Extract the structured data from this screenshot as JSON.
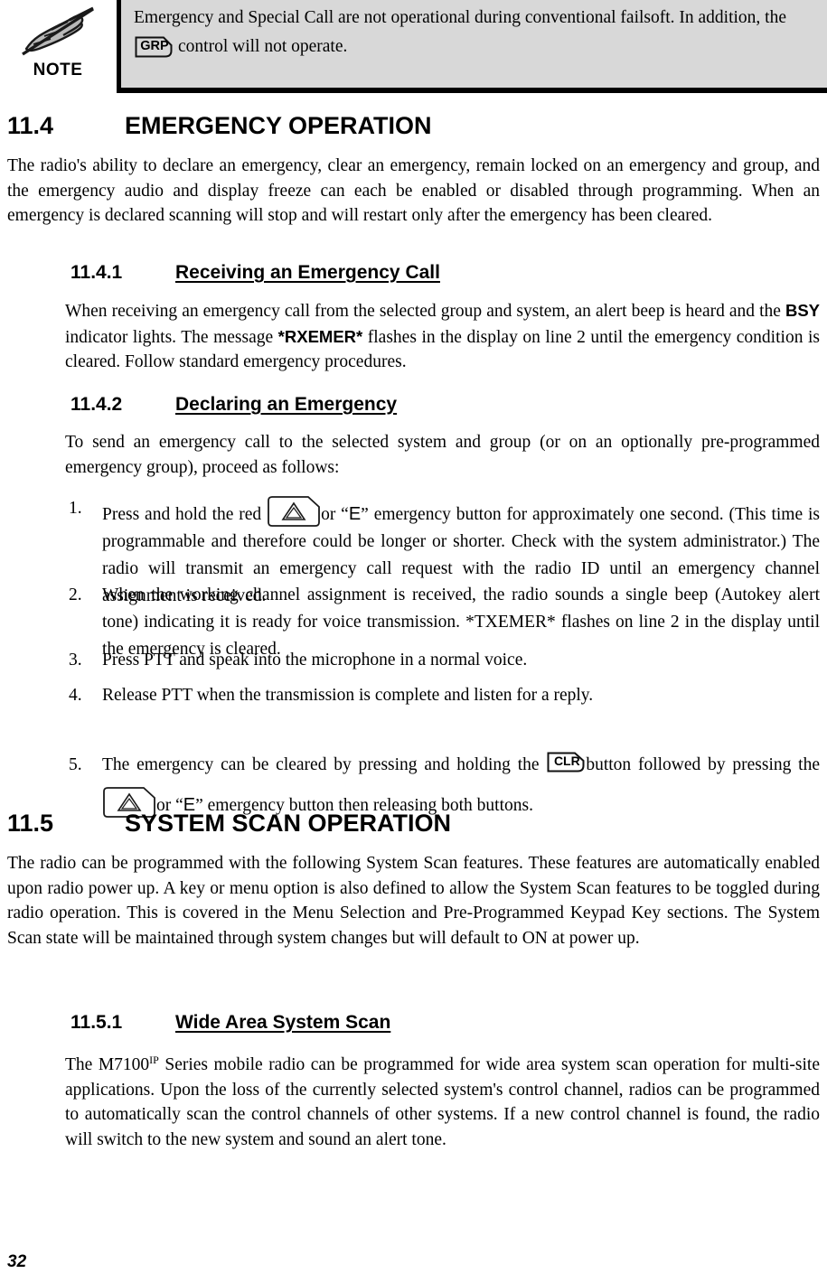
{
  "note": {
    "label": "NOTE",
    "icon": "hand-writing-crossed-out-icon",
    "text_before_key": "Emergency and Special Call are not operational during conventional failsoft. In addition, the",
    "key_label": "GRP",
    "text_after_key": "control will not operate."
  },
  "sections": {
    "s114": {
      "number": "11.4",
      "title": "EMERGENCY OPERATION",
      "body": "The radio's ability to declare an emergency, clear an emergency, remain locked on an emergency and group, and the emergency audio and display freeze can each be enabled or disabled through programming. When an emergency is declared scanning will stop and will restart only after the emergency has been cleared."
    },
    "s1141": {
      "number": "11.4.1",
      "title": "Receiving an Emergency Call",
      "body_part1": "When receiving an emergency call from the selected group and system, an alert beep is heard and the",
      "bold1": "BSY",
      "body_part2": "indicator lights.  The message",
      "bold2": "*RXEMER*",
      "body_part3": "flashes in the display on line 2 until the emergency condition is cleared. Follow standard emergency procedures."
    },
    "s1142": {
      "number": "11.4.2",
      "title": "Declaring an Emergency",
      "intro": "To send an emergency call to the selected system and group (or on an optionally pre-programmed emergency group), proceed as follows:",
      "steps": [
        {
          "num": "1.",
          "part1": "Press and hold the red",
          "key": "emergency-triangle-icon",
          "part2": "or “",
          "e_label": "E",
          "part3": "” emergency button for approximately one second. (This time is programmable and therefore could be longer or shorter. Check with the system administrator.) The radio will transmit an emergency call request with the radio ID until an emergency channel assignment is received."
        },
        {
          "num": "2.",
          "part1": "When the working channel assignment is received, the radio sounds a single beep (Autokey alert tone) indicating it is ready for voice transmission. *TXEMER* flashes on line 2 in the display until the emergency is cleared."
        },
        {
          "num": "3.",
          "part1": "Press PTT and speak into the microphone in a normal voice."
        },
        {
          "num": "4.",
          "part1": "Release PTT when the transmission is complete and listen for a reply."
        },
        {
          "num": "5.",
          "part1": "The emergency can be cleared by pressing and holding the",
          "key1": "CLR",
          "part2": "button followed by pressing the",
          "key2": "emergency-triangle-icon",
          "part3": "or “",
          "e_label": "E",
          "part4": "” emergency button then releasing both buttons."
        }
      ]
    },
    "s115": {
      "number": "11.5",
      "title": "SYSTEM SCAN OPERATION",
      "body": "The radio can be programmed with the following System Scan features. These features are automatically enabled upon radio power up. A key or menu option is also defined to allow the System Scan features to be toggled during radio operation. This is covered in the Menu Selection and Pre-Programmed Keypad Key sections. The System Scan state will be maintained through system changes but will default to ON at power up."
    },
    "s1151": {
      "number": "11.5.1",
      "title": "Wide Area System Scan",
      "body_part1": "The M7100",
      "superscript": "IP",
      "body_part2": "Series mobile radio can be programmed for wide area system scan operation for multi-site applications. Upon the loss of the currently selected system's control channel, radios can be programmed to automatically scan the control channels of other systems. If a new control channel is found, the radio will switch to the new system and sound an alert tone."
    }
  },
  "footer": {
    "page_number": "32"
  },
  "colors": {
    "note_background": "#d8d8d8",
    "rule": "#000000",
    "text": "#000000"
  }
}
